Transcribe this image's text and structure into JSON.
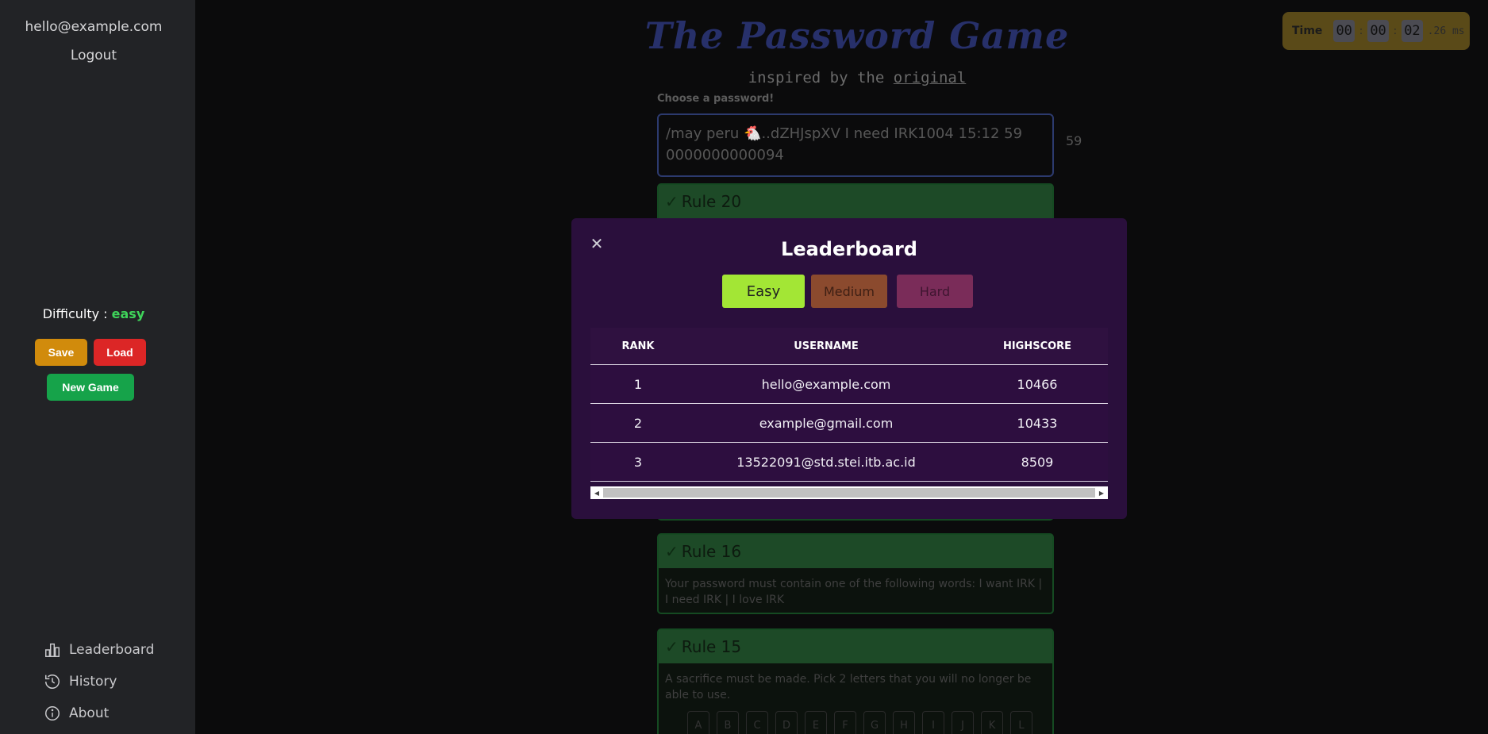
{
  "sidebar": {
    "user_email": "hello@example.com",
    "logout_label": "Logout",
    "difficulty_label": "Difficulty :",
    "difficulty_value": "easy",
    "save_label": "Save",
    "load_label": "Load",
    "new_game_label": "New Game",
    "nav": [
      {
        "label": "Leaderboard",
        "icon": "bar-chart-icon"
      },
      {
        "label": "History",
        "icon": "history-icon"
      },
      {
        "label": "About",
        "icon": "info-icon"
      }
    ]
  },
  "header": {
    "title": "The Password Game",
    "subtitle_prefix": "inspired by the",
    "subtitle_link": "original"
  },
  "password": {
    "label": "Choose a password!",
    "value": "/may peru 🐔..dZHJspXV I need IRK1004 15:12 59 0000000000094",
    "char_count": "59"
  },
  "timer": {
    "label": "Time",
    "hours": "00",
    "minutes": "00",
    "seconds": "02",
    "ms": ".26 ms"
  },
  "rules": [
    {
      "title": "Rule 20",
      "text": ""
    },
    {
      "title": "Rule 16",
      "text": "Your password must contain one of the following words: I want IRK | I need IRK | I love IRK"
    },
    {
      "title": "Rule 15",
      "text": "A sacrifice must be made. Pick 2 letters that you will no longer be able to use."
    }
  ],
  "sacrifice_letters": [
    "A",
    "B",
    "C",
    "D",
    "E",
    "F",
    "G",
    "H",
    "I",
    "J",
    "K",
    "L"
  ],
  "modal": {
    "title": "Leaderboard",
    "tabs": [
      "Easy",
      "Medium",
      "Hard"
    ],
    "columns": [
      "RANK",
      "USERNAME",
      "HIGHSCORE"
    ],
    "rows": [
      {
        "rank": "1",
        "username": "hello@example.com",
        "score": "10466"
      },
      {
        "rank": "2",
        "username": "example@gmail.com",
        "score": "10433"
      },
      {
        "rank": "3",
        "username": "13522091@std.stei.itb.ac.id",
        "score": "8509"
      }
    ]
  },
  "colors": {
    "sidebar_bg": "#222326",
    "modal_bg": "#2a0f3c",
    "easy": "#a3e635",
    "save": "#d18b0c",
    "load": "#dc2626",
    "new_game": "#16a34a"
  }
}
